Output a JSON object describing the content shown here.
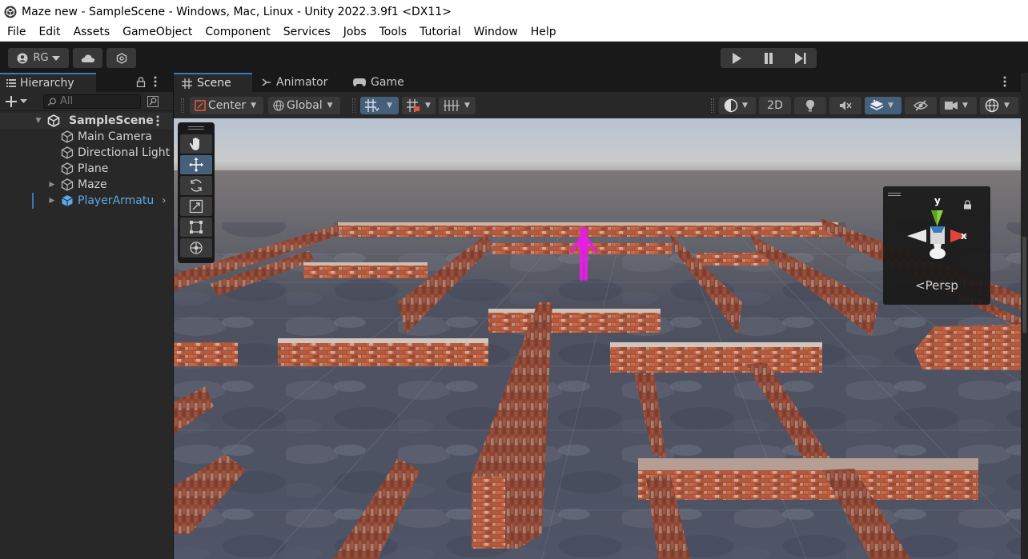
{
  "window": {
    "title": "Maze new - SampleScene - Windows, Mac, Linux - Unity 2022.3.9f1 <DX11>"
  },
  "menu": [
    "File",
    "Edit",
    "Assets",
    "GameObject",
    "Component",
    "Services",
    "Jobs",
    "Tools",
    "Tutorial",
    "Window",
    "Help"
  ],
  "toolbar": {
    "account_label": "RG"
  },
  "hierarchy": {
    "tab_label": "Hierarchy",
    "search_placeholder": "All",
    "scene_name": "SampleScene",
    "items": [
      {
        "label": "Main Camera",
        "expandable": false,
        "prefab": false
      },
      {
        "label": "Directional Light",
        "expandable": false,
        "prefab": false
      },
      {
        "label": "Plane",
        "expandable": false,
        "prefab": false
      },
      {
        "label": "Maze",
        "expandable": true,
        "prefab": false
      },
      {
        "label": "PlayerArmature",
        "expandable": true,
        "prefab": true
      }
    ]
  },
  "scene_view": {
    "tabs": [
      "Scene",
      "Animator",
      "Game"
    ],
    "active_tab": "Scene",
    "pivot_mode": "Center",
    "pivot_rotation": "Global",
    "mode_2d_label": "2D",
    "gizmo_axes": {
      "y": "y",
      "x": "x"
    },
    "projection_label": "Persp"
  },
  "colors": {
    "accent": "#3a79bb",
    "prefab_text": "#5fa8e6",
    "player": "#e51de5"
  }
}
